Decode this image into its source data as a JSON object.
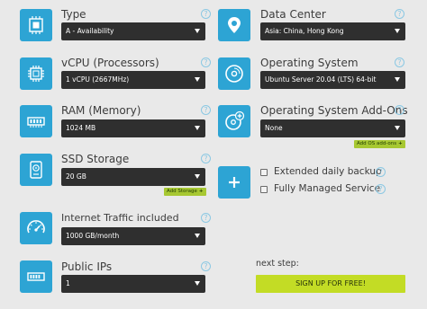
{
  "type": {
    "label": "Type",
    "value": "A - Availability"
  },
  "datacenter": {
    "label": "Data Center",
    "value": "Asia: China, Hong Kong"
  },
  "vcpu": {
    "label": "vCPU (Processors)",
    "value": "1 vCPU (2667MHz)"
  },
  "os": {
    "label": "Operating System",
    "value": "Ubuntu Server 20.04 (LTS) 64-bit"
  },
  "ram": {
    "label": "RAM (Memory)",
    "value": "1024 MB"
  },
  "os_addons": {
    "label": "Operating System Add-Ons",
    "value": "None",
    "add_label": "Add OS add-ons"
  },
  "ssd": {
    "label": "SSD Storage",
    "value": "20 GB",
    "add_label": "Add Storage"
  },
  "extras": {
    "backup_label": "Extended daily backup",
    "managed_label": "Fully Managed Service"
  },
  "traffic": {
    "label": "Internet Traffic included",
    "value": "1000 GB/month"
  },
  "ips": {
    "label": "Public IPs",
    "value": "1"
  },
  "next": {
    "label": "next step:",
    "button": "SIGN UP FOR FREE!"
  },
  "glyphs": {
    "help": "?",
    "plus": "+"
  },
  "colors": {
    "accent": "#2da4d4",
    "select_bg": "#2f2f2f",
    "signup": "#c3dc25",
    "add_button": "#a7c832",
    "background": "#e9e9e9"
  }
}
